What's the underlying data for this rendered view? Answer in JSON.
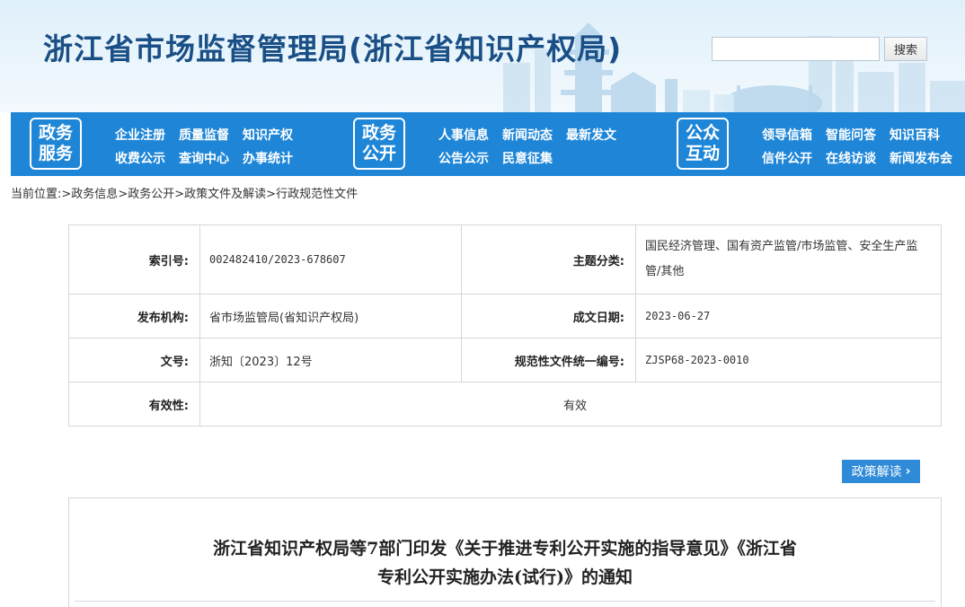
{
  "header": {
    "site_title": "浙江省市场监督管理局(浙江省知识产权局)",
    "search_placeholder": "",
    "search_button": "搜索"
  },
  "nav": {
    "groups": [
      {
        "badge": [
          "政务",
          "服务"
        ],
        "rows": [
          [
            "企业注册",
            "质量监督",
            "知识产权"
          ],
          [
            "收费公示",
            "查询中心",
            "办事统计"
          ]
        ]
      },
      {
        "badge": [
          "政务",
          "公开"
        ],
        "rows": [
          [
            "人事信息",
            "新闻动态",
            "最新发文"
          ],
          [
            "公告公示",
            "民意征集"
          ]
        ]
      },
      {
        "badge": [
          "公众",
          "互动"
        ],
        "rows": [
          [
            "领导信箱",
            "智能问答",
            "知识百科"
          ],
          [
            "信件公开",
            "在线访谈",
            "新闻发布会"
          ]
        ]
      }
    ]
  },
  "breadcrumb": {
    "prefix": "当前位置:",
    "sep": ">",
    "items": [
      "政务信息",
      "政务公开",
      "政策文件及解读",
      "行政规范性文件"
    ]
  },
  "info": {
    "index_label": "索引号:",
    "index_value": "002482410/2023-678607",
    "topic_label": "主题分类:",
    "topic_value": "国民经济管理、国有资产监管/市场监管、安全生产监管/其他",
    "publisher_label": "发布机构:",
    "publisher_value": "省市场监管局(省知识产权局)",
    "date_label": "成文日期:",
    "date_value": "2023-06-27",
    "docno_label": "文号:",
    "docno_value": "浙知〔2023〕12号",
    "code_label": "规范性文件统一编号:",
    "code_value": "ZJSP68-2023-0010",
    "validity_label": "有效性:",
    "validity_value": "有效"
  },
  "policy_button": {
    "label": "政策解读",
    "chevron": "›"
  },
  "article": {
    "title_line1": "浙江省知识产权局等7部门印发《关于推进专利公开实施的指导意见》《浙江省",
    "title_line2": "专利公开实施办法(试行)》的通知"
  }
}
